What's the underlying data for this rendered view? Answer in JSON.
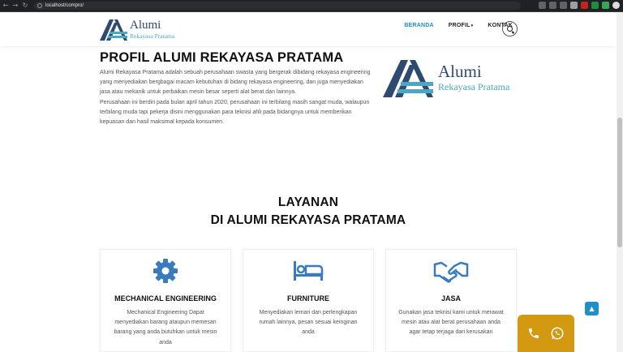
{
  "browser": {
    "url": "localhost/compro/"
  },
  "header": {
    "logo_line1": "Alumi",
    "logo_line2": "Rekayasa Pratama",
    "nav": {
      "beranda": "BERANDA",
      "profil": "PROFIL",
      "kontak": "KONTAK"
    }
  },
  "profile": {
    "title": "PROFIL ALUMI REKAYASA PRATAMA",
    "paragraph1": "Alumi Rekayasa Pratama adalah sebuah perusahaan swasta yang bergerak dibidang rekayasa engineering yang menyediakan bergbagai macam kebutuhan di bidang rekayasa engineering, dan juga menyediakan jasa atau mekanik untuk perbaikan mesin besar seperti alat berat dan lainnya.",
    "paragraph2": "Perusahaan ini berdiri pada bulan april tahun 2020, perusahaan ini terbilang masih sangat muda, walaupun terbilang muda tapi pekerja disini menggunakan para teknisi ahli pada bidangnya untuk memberikan kepuasan dan hasil maksimal kepada konsumen.",
    "logo_line1": "Alumi",
    "logo_line2": "Rekayasa Pratama"
  },
  "layanan": {
    "title_line1": "LAYANAN",
    "title_line2": "DI ALUMI REKAYASA PRATAMA",
    "cards": [
      {
        "icon": "gear-icon",
        "title": "MECHANICAL ENGINEERING",
        "text": "Mechanical Engineering Dapat menyediakan barang ataupun memesan barang yang anda butuhkan untuk mesin anda"
      },
      {
        "icon": "bed-icon",
        "title": "FURNITURE",
        "text": "Menyediakan lemari dan perlengkapan rumah lainnya, pesan sesuai keinginan anda"
      },
      {
        "icon": "handshake-icon",
        "title": "JASA",
        "text": "Gunakan jasa teknisi kami untuk merawat mesin atau alat berat perusahaan anda agar tetap terjaga dari kerusakan"
      }
    ]
  },
  "colors": {
    "accent": "#1e8fc9",
    "logo_dark": "#2f4a6f",
    "logo_light": "#4aa8c2",
    "contact_bg": "#d39a11",
    "icon_blue": "#3a7bbf"
  }
}
